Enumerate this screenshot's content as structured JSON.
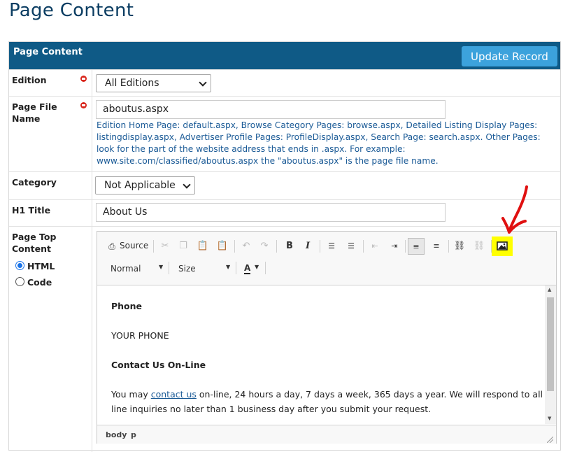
{
  "page_title": "Page Content",
  "header": {
    "title": "Page Content",
    "update_button": "Update Record"
  },
  "edition": {
    "label": "Edition",
    "selected": "All Editions"
  },
  "page_file": {
    "label_line1": "Page File",
    "label_line2": "Name",
    "value": "aboutus.aspx",
    "help_lines": [
      "Edition Home Page: default.aspx, Browse Category Pages: browse.aspx, Detailed Listing Display Pages:",
      "listingdisplay.aspx, Advertiser Profile Pages: ProfileDisplay.aspx, Search Page: search.aspx. Other Pages:",
      "look for the part of the website address that ends in .aspx. For example:",
      "www.site.com/classified/aboutus.aspx the \"aboutus.aspx\" is the page file name."
    ]
  },
  "category": {
    "label": "Category",
    "selected": "Not Applicable"
  },
  "h1": {
    "label": "H1 Title",
    "value": "About Us"
  },
  "top_content": {
    "label_line1": "Page Top",
    "label_line2": "Content",
    "radio_html": "HTML",
    "radio_code": "Code"
  },
  "toolbar": {
    "source": "Source",
    "format": "Normal",
    "size": "Size",
    "font_color": "A"
  },
  "content": {
    "heading1": "Phone",
    "phone": "YOUR PHONE",
    "heading2": "Contact Us On-Line",
    "para_prefix": "You may ",
    "para_link": "contact us",
    "para_rest1": " on-line, 24 hours a day, 7 days a week, 365 days a year. We will respond to all on-",
    "para_line2": "line inquiries no later than 1 business day after you submit your request."
  },
  "status": {
    "path1": "body",
    "path2": "p"
  },
  "colors": {
    "header": "#0f5a86",
    "button": "#3ca2dc",
    "highlight": "#ffff00",
    "annotation": "#e01010",
    "link": "#1a5a96"
  }
}
